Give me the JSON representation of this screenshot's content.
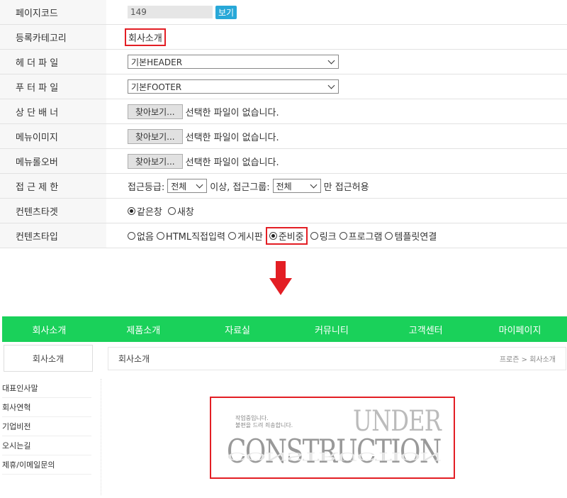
{
  "form": {
    "rows": [
      {
        "label": "페이지코드",
        "code_value": "149",
        "view_button": "보기"
      },
      {
        "label": "등록카테고리",
        "category": "회사소개"
      },
      {
        "label": "헤 더 파 일",
        "select": "기본HEADER"
      },
      {
        "label": "푸 터 파 일",
        "select": "기본FOOTER"
      },
      {
        "label": "상 단 배 너",
        "file_button": "찾아보기...",
        "file_status": "선택한 파일이 없습니다."
      },
      {
        "label": "메뉴이미지",
        "file_button": "찾아보기...",
        "file_status": "선택한 파일이 없습니다."
      },
      {
        "label": "메뉴롤오버",
        "file_button": "찾아보기...",
        "file_status": "선택한 파일이 없습니다."
      },
      {
        "label": "접 근 제 한",
        "level_label": "접근등급:",
        "level_value": "전체",
        "above_text": "이상, 접근그룹:",
        "group_value": "전체",
        "allow_text": "만 접근허용"
      },
      {
        "label": "컨텐츠타겟",
        "options": [
          "같은창",
          "새창"
        ],
        "selected": "같은창"
      },
      {
        "label": "컨텐츠타입",
        "options": [
          "없음",
          "HTML직접입력",
          "게시판",
          "준비중",
          "링크",
          "프로그램",
          "템플릿연결"
        ],
        "selected": "준비중"
      }
    ]
  },
  "colors": {
    "accent_red": "#e31e24",
    "nav_green": "#1ad15a",
    "view_blue": "#28a8d8"
  },
  "preview": {
    "nav": [
      "회사소개",
      "제품소개",
      "자료실",
      "커뮤니티",
      "고객센터",
      "마이페이지"
    ],
    "side_title": "회사소개",
    "side_items": [
      "대표인사말",
      "회사연혁",
      "기업비전",
      "오시는길",
      "제휴/이메일문의"
    ],
    "page_title": "회사소개",
    "breadcrumb": "프로즌 > 회사소개",
    "uc_line1": "작업중입니다.",
    "uc_line2": "불편을 드려 죄송합니다.",
    "uc_under": "UNDER",
    "uc_construction": "CONSTRUCTION"
  }
}
